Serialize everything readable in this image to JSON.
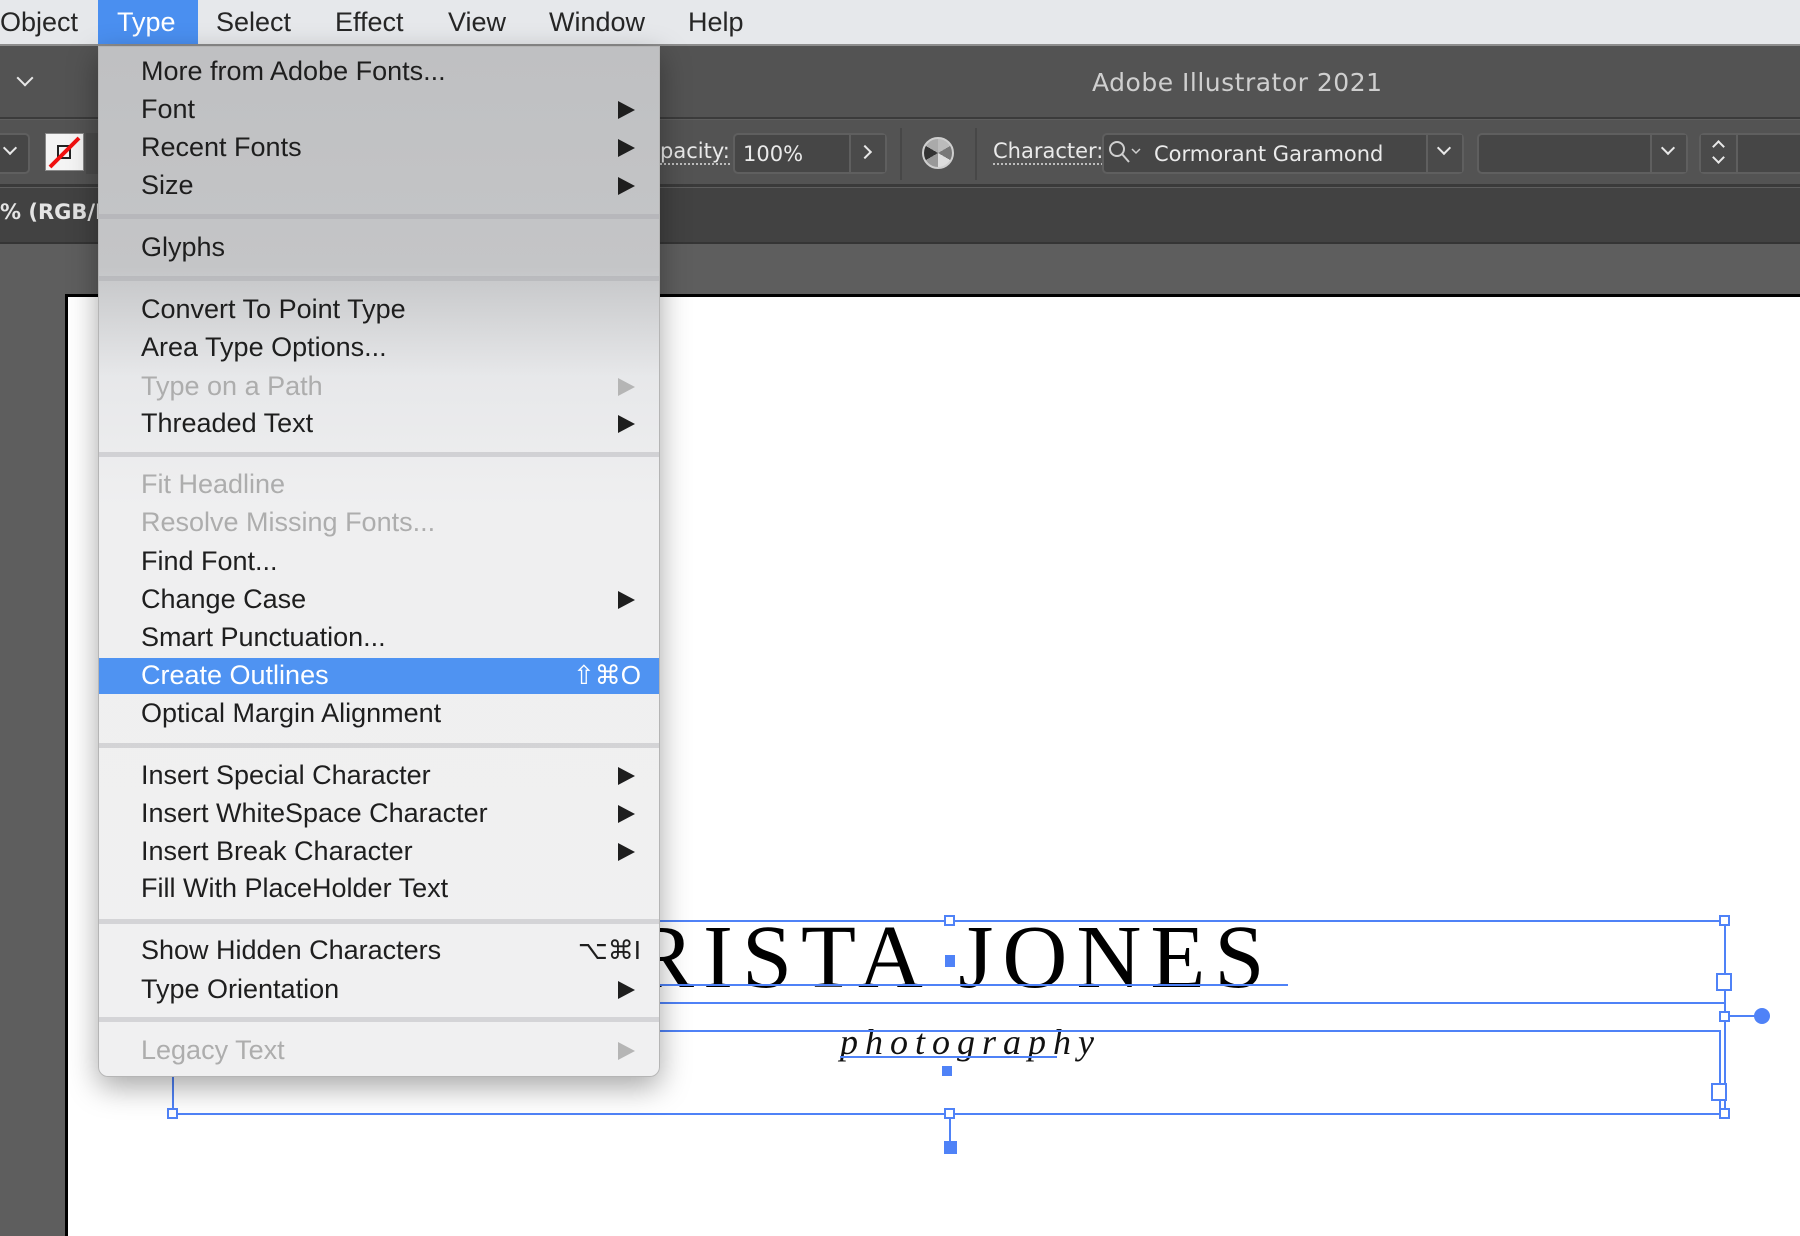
{
  "menubar": {
    "items": [
      {
        "label": "Object",
        "active": false
      },
      {
        "label": "Type",
        "active": true
      },
      {
        "label": "Select",
        "active": false
      },
      {
        "label": "Effect",
        "active": false
      },
      {
        "label": "View",
        "active": false
      },
      {
        "label": "Window",
        "active": false
      },
      {
        "label": "Help",
        "active": false
      }
    ]
  },
  "titlebar": {
    "title": "Adobe Illustrator 2021"
  },
  "controlbar": {
    "opacity_label": "Opacity:",
    "opacity_label_visible": "pacity:",
    "opacity_value": "100%",
    "character_label": "Character:",
    "font_family": "Cormorant Garamond",
    "font_style": "",
    "font_size": "",
    "fill_swatch": "none"
  },
  "tabbar": {
    "document_tab_visible": "% (RGB/Pr"
  },
  "type_menu": {
    "items": [
      {
        "label": "More from Adobe Fonts...",
        "submenu": false,
        "disabled": false
      },
      {
        "label": "Font",
        "submenu": true,
        "disabled": false
      },
      {
        "label": "Recent Fonts",
        "submenu": true,
        "disabled": false
      },
      {
        "label": "Size",
        "submenu": true,
        "disabled": false
      },
      {
        "label": "Glyphs",
        "submenu": false,
        "disabled": false
      },
      {
        "label": "Convert To Point Type",
        "submenu": false,
        "disabled": false
      },
      {
        "label": "Area Type Options...",
        "submenu": false,
        "disabled": false
      },
      {
        "label": "Type on a Path",
        "submenu": true,
        "disabled": true
      },
      {
        "label": "Threaded Text",
        "submenu": true,
        "disabled": false
      },
      {
        "label": "Fit Headline",
        "submenu": false,
        "disabled": true
      },
      {
        "label": "Resolve Missing Fonts...",
        "submenu": false,
        "disabled": true
      },
      {
        "label": "Find Font...",
        "submenu": false,
        "disabled": false
      },
      {
        "label": "Change Case",
        "submenu": true,
        "disabled": false
      },
      {
        "label": "Smart Punctuation...",
        "submenu": false,
        "disabled": false
      },
      {
        "label": "Create Outlines",
        "submenu": false,
        "disabled": false,
        "highlighted": true,
        "shortcut": "⇧⌘O"
      },
      {
        "label": "Optical Margin Alignment",
        "submenu": false,
        "disabled": false
      },
      {
        "label": "Insert Special Character",
        "submenu": true,
        "disabled": false
      },
      {
        "label": "Insert WhiteSpace Character",
        "submenu": true,
        "disabled": false
      },
      {
        "label": "Insert Break Character",
        "submenu": true,
        "disabled": false
      },
      {
        "label": "Fill With PlaceHolder Text",
        "submenu": false,
        "disabled": false
      },
      {
        "label": "Show Hidden Characters",
        "submenu": false,
        "disabled": false,
        "shortcut": "⌥⌘I"
      },
      {
        "label": "Type Orientation",
        "submenu": true,
        "disabled": false
      },
      {
        "label": "Legacy Text",
        "submenu": true,
        "disabled": true
      }
    ]
  },
  "artboard": {
    "headline_text": "KRISTA JONES",
    "subline_text": "photography"
  },
  "colors": {
    "menu_highlight": "#4f93f2",
    "selection": "#4f82f7",
    "panel_bg": "#535353"
  }
}
